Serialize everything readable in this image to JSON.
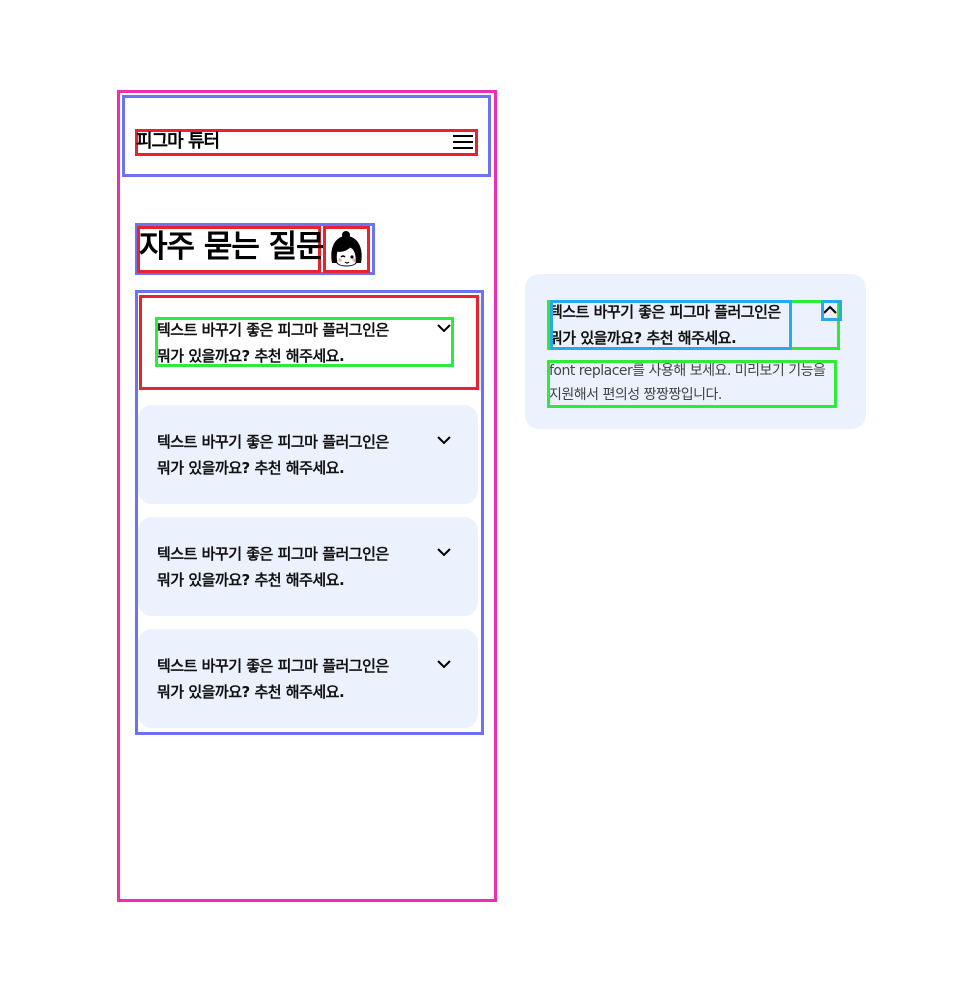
{
  "header": {
    "logo": "피그마 튜터",
    "menu_icon": "hamburger-menu-icon"
  },
  "page": {
    "title": "자주 묻는 질문",
    "avatar_icon": "character-avatar-icon"
  },
  "faq": {
    "items": [
      {
        "line1": "텍스트 바꾸기 좋은 피그마 플러그인은",
        "line2": "뭐가 있을까요? 추천 해주세요."
      },
      {
        "line1": "텍스트 바꾸기 좋은 피그마 플러그인은",
        "line2": "뭐가 있을까요? 추천 해주세요."
      },
      {
        "line1": "텍스트 바꾸기 좋은 피그마 플러그인은",
        "line2": "뭐가 있을까요? 추천 해주세요."
      },
      {
        "line1": "텍스트 바꾸기 좋은 피그마 플러그인은",
        "line2": "뭐가 있을까요? 추천 해주세요."
      }
    ],
    "chevron_icon": "chevron-down-icon"
  },
  "expanded": {
    "question_line1": "텍스트 바꾸기 좋은 피그마 플러그인은",
    "question_line2": "뭐가 있을까요? 추천 해주세요.",
    "answer_line1": "font replacer를 사용해 보세요. 미리보기 기능을",
    "answer_line2": "지원해서 편의성 짱짱짱입니다.",
    "chevron_icon": "chevron-up-icon"
  },
  "colors": {
    "card_bg": "#ecf2fd",
    "frame_pink": "#ee2fb3",
    "frame_blue": "#6b73f2",
    "frame_red": "#e8232f",
    "frame_green": "#2fe93b",
    "frame_cyan": "#2aa8ee"
  }
}
